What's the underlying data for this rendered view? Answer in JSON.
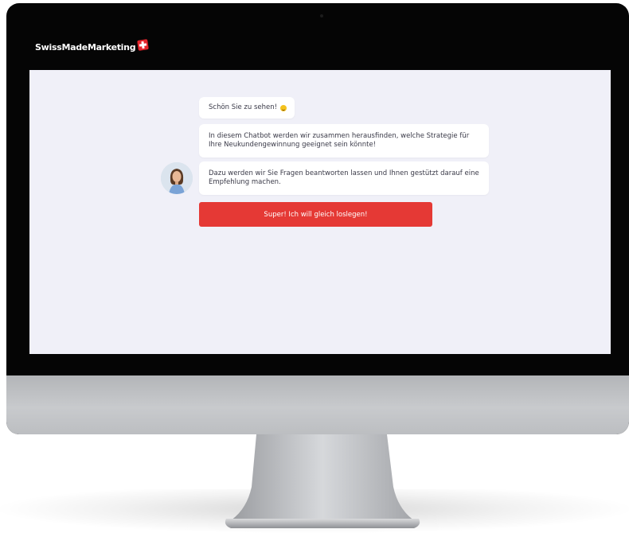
{
  "header": {
    "brand_name": "SwissMadeMarketing",
    "brand_icon": "swiss-flag-icon"
  },
  "chat": {
    "messages": [
      {
        "text": "Schön Sie zu sehen!",
        "icon": "smile-icon"
      },
      {
        "text": "In diesem Chatbot werden wir zusammen herausfinden, welche Strategie für Ihre Neukundengewinnung geeignet sein könnte!"
      },
      {
        "text": "Dazu werden wir Sie Fragen beantworten lassen und Ihnen gestützt darauf eine Empfehlung machen."
      }
    ],
    "cta_label": "Super! Ich will gleich loslegen!"
  },
  "colors": {
    "accent": "#e53935",
    "screen_background": "#f0f0f8",
    "bubble_background": "#ffffff",
    "bezel": "#050505"
  }
}
